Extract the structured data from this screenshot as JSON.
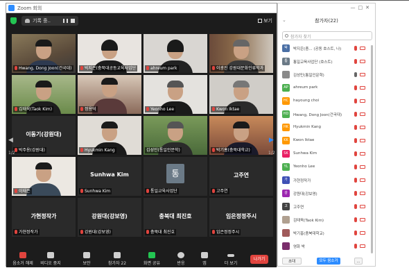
{
  "titlebar": {
    "app_title": "Zoom 회의"
  },
  "topbar": {
    "recording_label": "기록 중..",
    "view_label": "보기"
  },
  "tiles": [
    {
      "name": "Hwang, Dong Joon(건국대)"
    },
    {
      "name": "박지은(충북대공동교육사업단"
    },
    {
      "name": "ahreum park"
    },
    {
      "name": "이광진 강원대문화인류학과"
    },
    {
      "name": "김태욱(Taok Kim)"
    },
    {
      "name": "정용덕"
    },
    {
      "name": "Yeonho Lee"
    },
    {
      "name": "Kwon Iktae"
    },
    {
      "name": "박주용(강원대)",
      "center": "이동기(강원대)"
    },
    {
      "name": "Hyukmin Kang"
    },
    {
      "name": "김성민(통일인문학)"
    },
    {
      "name": "박기홍(충북대학교)"
    },
    {
      "name": "이태은"
    },
    {
      "name": "Sunhwa Kim",
      "center": "Sunhwa Kim"
    },
    {
      "name": "통일교육사업단",
      "avatar": "통"
    },
    {
      "name": "고주연",
      "center": "고주연"
    },
    {
      "name": "가현정작가",
      "center": "가현정작가"
    },
    {
      "name": "강원대(강보영)",
      "center": "강원대(강보영)"
    },
    {
      "name": "충북대 최진호",
      "center": "충북대 최진호"
    },
    {
      "name": "임은정정주시",
      "center": "임은정정주시"
    }
  ],
  "pager": {
    "left": "1/2",
    "right": "1/2"
  },
  "toolbar": {
    "mute": "음소거 해제",
    "video": "비디오 중지",
    "security": "보안",
    "participants": "참가자",
    "participants_count": "22",
    "share": "화면 공유",
    "reactions": "반응",
    "apps": "앱",
    "more": "더 보기",
    "leave": "나가기"
  },
  "panel": {
    "title": "참가자(22)",
    "search_placeholder": "참가자 찾기",
    "invite": "초대",
    "mute_all": "모두 음소거",
    "more": "..."
  },
  "participants": [
    {
      "initial": "박",
      "name": "박지은(충... (공동 호스트, 나)",
      "color": "#4a6fa5",
      "mic_on": false
    },
    {
      "initial": "통",
      "name": "통일교육사업단 (호스트)",
      "color": "#6b7a87",
      "mic_on": false
    },
    {
      "initial": "",
      "name": "김성민(통일인문학)",
      "color": "#8a8a8a",
      "mic_on": true
    },
    {
      "initial": "AP",
      "name": "ahreum park",
      "color": "#4caf50",
      "mic_on": false
    },
    {
      "initial": "HC",
      "name": "hayoung choi",
      "color": "#ff9800",
      "mic_on": false
    },
    {
      "initial": "HD",
      "name": "Hwang, Dong Joon(건국대)",
      "color": "#4caf50",
      "mic_on": false
    },
    {
      "initial": "HK",
      "name": "Hyukmin Kang",
      "color": "#ff9800",
      "mic_on": false
    },
    {
      "initial": "KK",
      "name": "Kwon Iktae",
      "color": "#ff9800",
      "mic_on": false
    },
    {
      "initial": "SK",
      "name": "Sunhwa Kim",
      "color": "#e91e63",
      "mic_on": false
    },
    {
      "initial": "YL",
      "name": "Yeonho Lee",
      "color": "#4caf50",
      "mic_on": false
    },
    {
      "initial": "가",
      "name": "가현정작가",
      "color": "#3f51b5",
      "mic_on": false
    },
    {
      "initial": "강",
      "name": "강원대(강보영)",
      "color": "#9c27b0",
      "mic_on": false
    },
    {
      "initial": "고",
      "name": "고주연",
      "color": "#424242",
      "mic_on": false
    },
    {
      "initial": "",
      "name": "김태욱(Taok Kim)",
      "color": "#b0a090",
      "mic_on": false
    },
    {
      "initial": "",
      "name": "박기홍(충북대학교)",
      "color": "#a05a5a",
      "mic_on": false
    },
    {
      "initial": "",
      "name": "영화 박",
      "color": "#7a2d6b",
      "mic_on": false
    }
  ]
}
